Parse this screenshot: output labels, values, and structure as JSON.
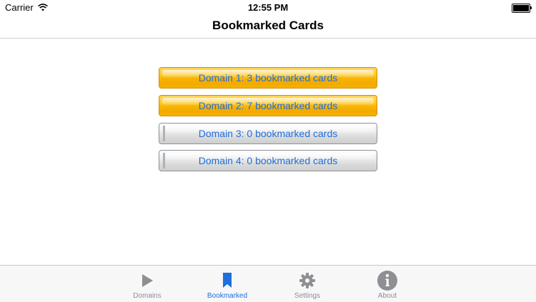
{
  "status_bar": {
    "carrier": "Carrier",
    "time": "12:55 PM"
  },
  "nav": {
    "title": "Bookmarked Cards"
  },
  "domains": [
    {
      "label": "Domain 1: 3 bookmarked cards",
      "style": "gold"
    },
    {
      "label": "Domain 2: 7 bookmarked cards",
      "style": "gold"
    },
    {
      "label": "Domain 3: 0 bookmarked cards",
      "style": "silver"
    },
    {
      "label": "Domain 4: 0 bookmarked cards",
      "style": "silver"
    }
  ],
  "tabs": [
    {
      "label": "Domains",
      "icon": "play-icon",
      "active": false
    },
    {
      "label": "Bookmarked",
      "icon": "bookmark-icon",
      "active": true
    },
    {
      "label": "Settings",
      "icon": "gear-icon",
      "active": false
    },
    {
      "label": "About",
      "icon": "info-icon",
      "active": false
    }
  ],
  "colors": {
    "accent": "#1f6fdc",
    "inactive_tab": "#8e8e93",
    "gold_button": "#f8b400",
    "silver_button": "#d9d9d9"
  }
}
